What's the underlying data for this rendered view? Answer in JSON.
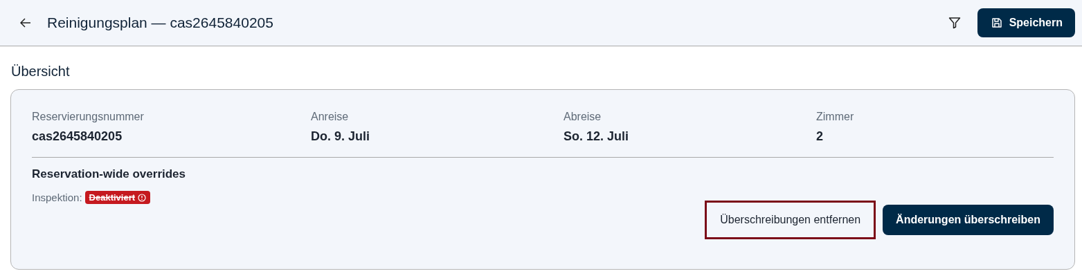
{
  "header": {
    "title": "Reinigungsplan — cas2645840205",
    "save_button": "Speichern"
  },
  "section_title": "Übersicht",
  "fields": [
    {
      "label": "Reservierungsnummer",
      "value": "cas2645840205"
    },
    {
      "label": "Anreise",
      "value": "Do. 9. Juli"
    },
    {
      "label": "Abreise",
      "value": "So. 12. Juli"
    },
    {
      "label": "Zimmer",
      "value": "2"
    }
  ],
  "overrides": {
    "title": "Reservation-wide overrides",
    "label": "Inspektion:",
    "badge": "Deaktiviert",
    "struck": true
  },
  "buttons": [
    {
      "label": "Überschreibungen entfernen",
      "kind": "secondary",
      "focused": true
    },
    {
      "label": "Änderungen überschreiben",
      "kind": "primary",
      "focused": false
    }
  ]
}
